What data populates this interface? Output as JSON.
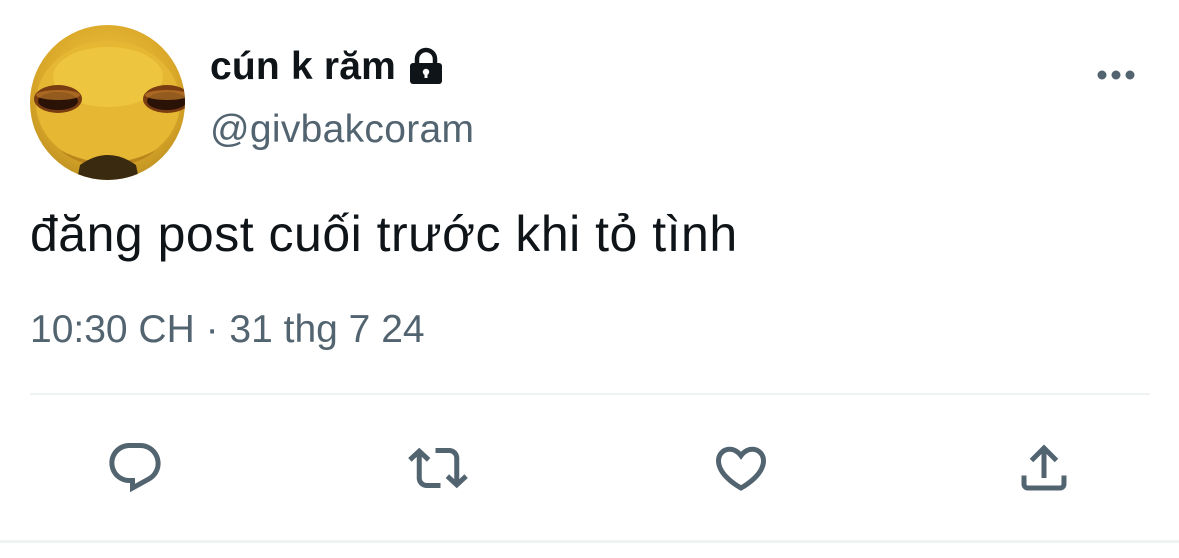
{
  "author": {
    "display_name": "cún k răm",
    "handle": "@givbakcoram",
    "protected": true,
    "avatar_icon": "yellow-alien-avatar"
  },
  "tweet": {
    "text": "đăng post cuối trước khi tỏ tình",
    "timestamp": "10:30 CH · 31 thg 7 24"
  },
  "actions": {
    "reply_icon": "reply-icon",
    "retweet_icon": "retweet-icon",
    "like_icon": "heart-icon",
    "share_icon": "share-icon",
    "more_icon": "more-icon"
  },
  "colors": {
    "primary_text": "#0f1419",
    "secondary_text": "#536471",
    "divider": "#eff3f4"
  }
}
